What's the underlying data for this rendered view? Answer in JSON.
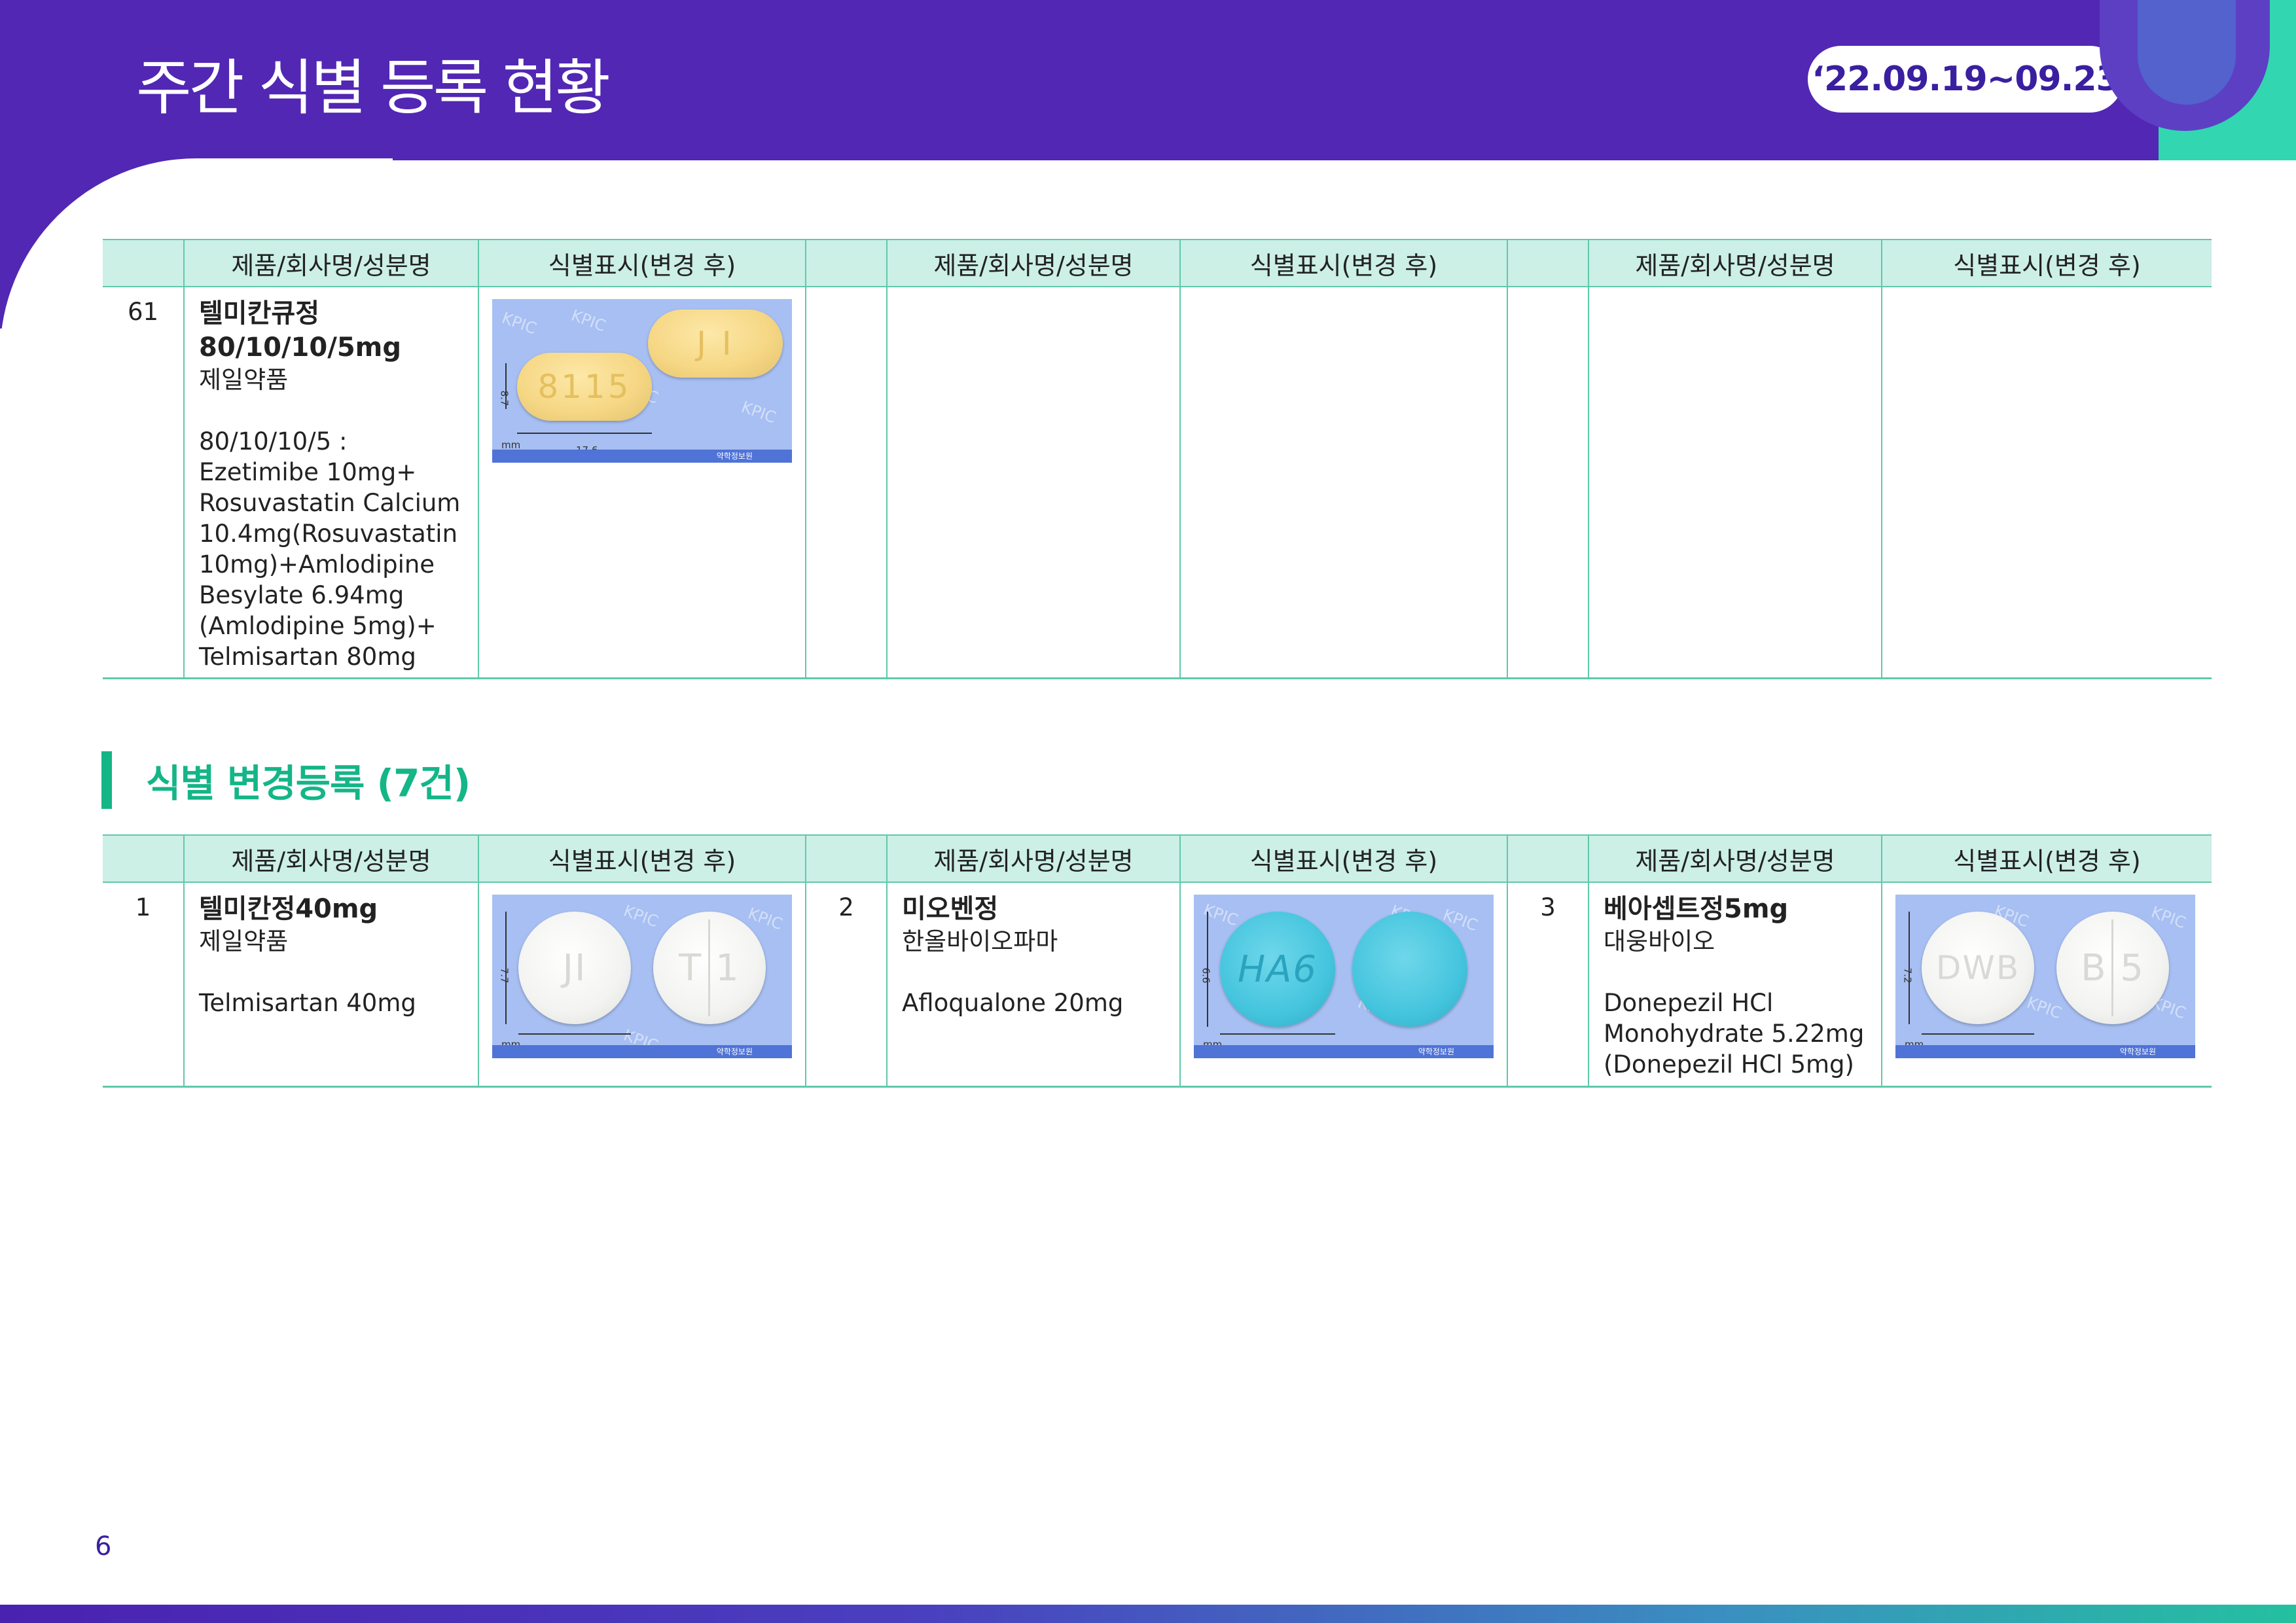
{
  "header": {
    "title": "주간 식별 등록 현황",
    "date_range": "‘22.09.19~09.23"
  },
  "table_headers": {
    "product": "제품/회사명/성분명",
    "mark": "식별표시(변경 후)"
  },
  "section1": {
    "rows": [
      {
        "num": "61",
        "name_line1": "텔미칸큐정",
        "name_line2": "80/10/10/5mg",
        "company": "제일약품",
        "ingredient_lines": [
          "80/10/10/5 :",
          "Ezetimibe 10mg+",
          "Rosuvastatin Calcium",
          "10.4mg(Rosuvastatin",
          "10mg)+Amlodipine",
          "Besylate 6.94mg",
          "(Amlodipine 5mg)+",
          "Telmisartan 80mg"
        ],
        "pill": {
          "front_mark": "8115",
          "back_mark": "J I",
          "size_h": "8.7",
          "size_w": "17.6",
          "unit": "mm",
          "color": "#f6d886"
        }
      }
    ]
  },
  "section2": {
    "title": "식별 변경등록 (7건)",
    "rows": [
      {
        "num": "1",
        "name": "텔미칸정40mg",
        "company": "제일약품",
        "ingredient_lines": [
          "Telmisartan 40mg"
        ],
        "pill": {
          "front_mark": "JI",
          "back_mark": "T 1",
          "size_h": "7.7",
          "size_w": "7.7",
          "unit": "mm",
          "color": "#f3f3f1"
        }
      },
      {
        "num": "2",
        "name": "미오벤정",
        "company": "한올바이오파마",
        "ingredient_lines": [
          "Afloqualone 20mg"
        ],
        "pill": {
          "front_mark": "HA6",
          "size_h": "6.6",
          "size_w": "6.6",
          "unit": "mm",
          "color": "#45c5de"
        }
      },
      {
        "num": "3",
        "name": "베아셉트정5mg",
        "company": "대웅바이오",
        "ingredient_lines": [
          "Donepezil HCl",
          "Monohydrate 5.22mg",
          "(Donepezil HCl 5mg)"
        ],
        "pill": {
          "front_mark": "DWB",
          "back_mark": "B 5",
          "size_h": "7.2",
          "size_w": "7.2",
          "unit": "mm",
          "color": "#f3f3f1"
        }
      }
    ]
  },
  "watermark": "KPIC",
  "photo_footer": "약학정보원",
  "page_number": "6",
  "colors": {
    "header_purple": "#5127b4",
    "accent_green": "#14b587",
    "table_header_bg": "#ccefe6",
    "table_border": "#60c9aa"
  }
}
